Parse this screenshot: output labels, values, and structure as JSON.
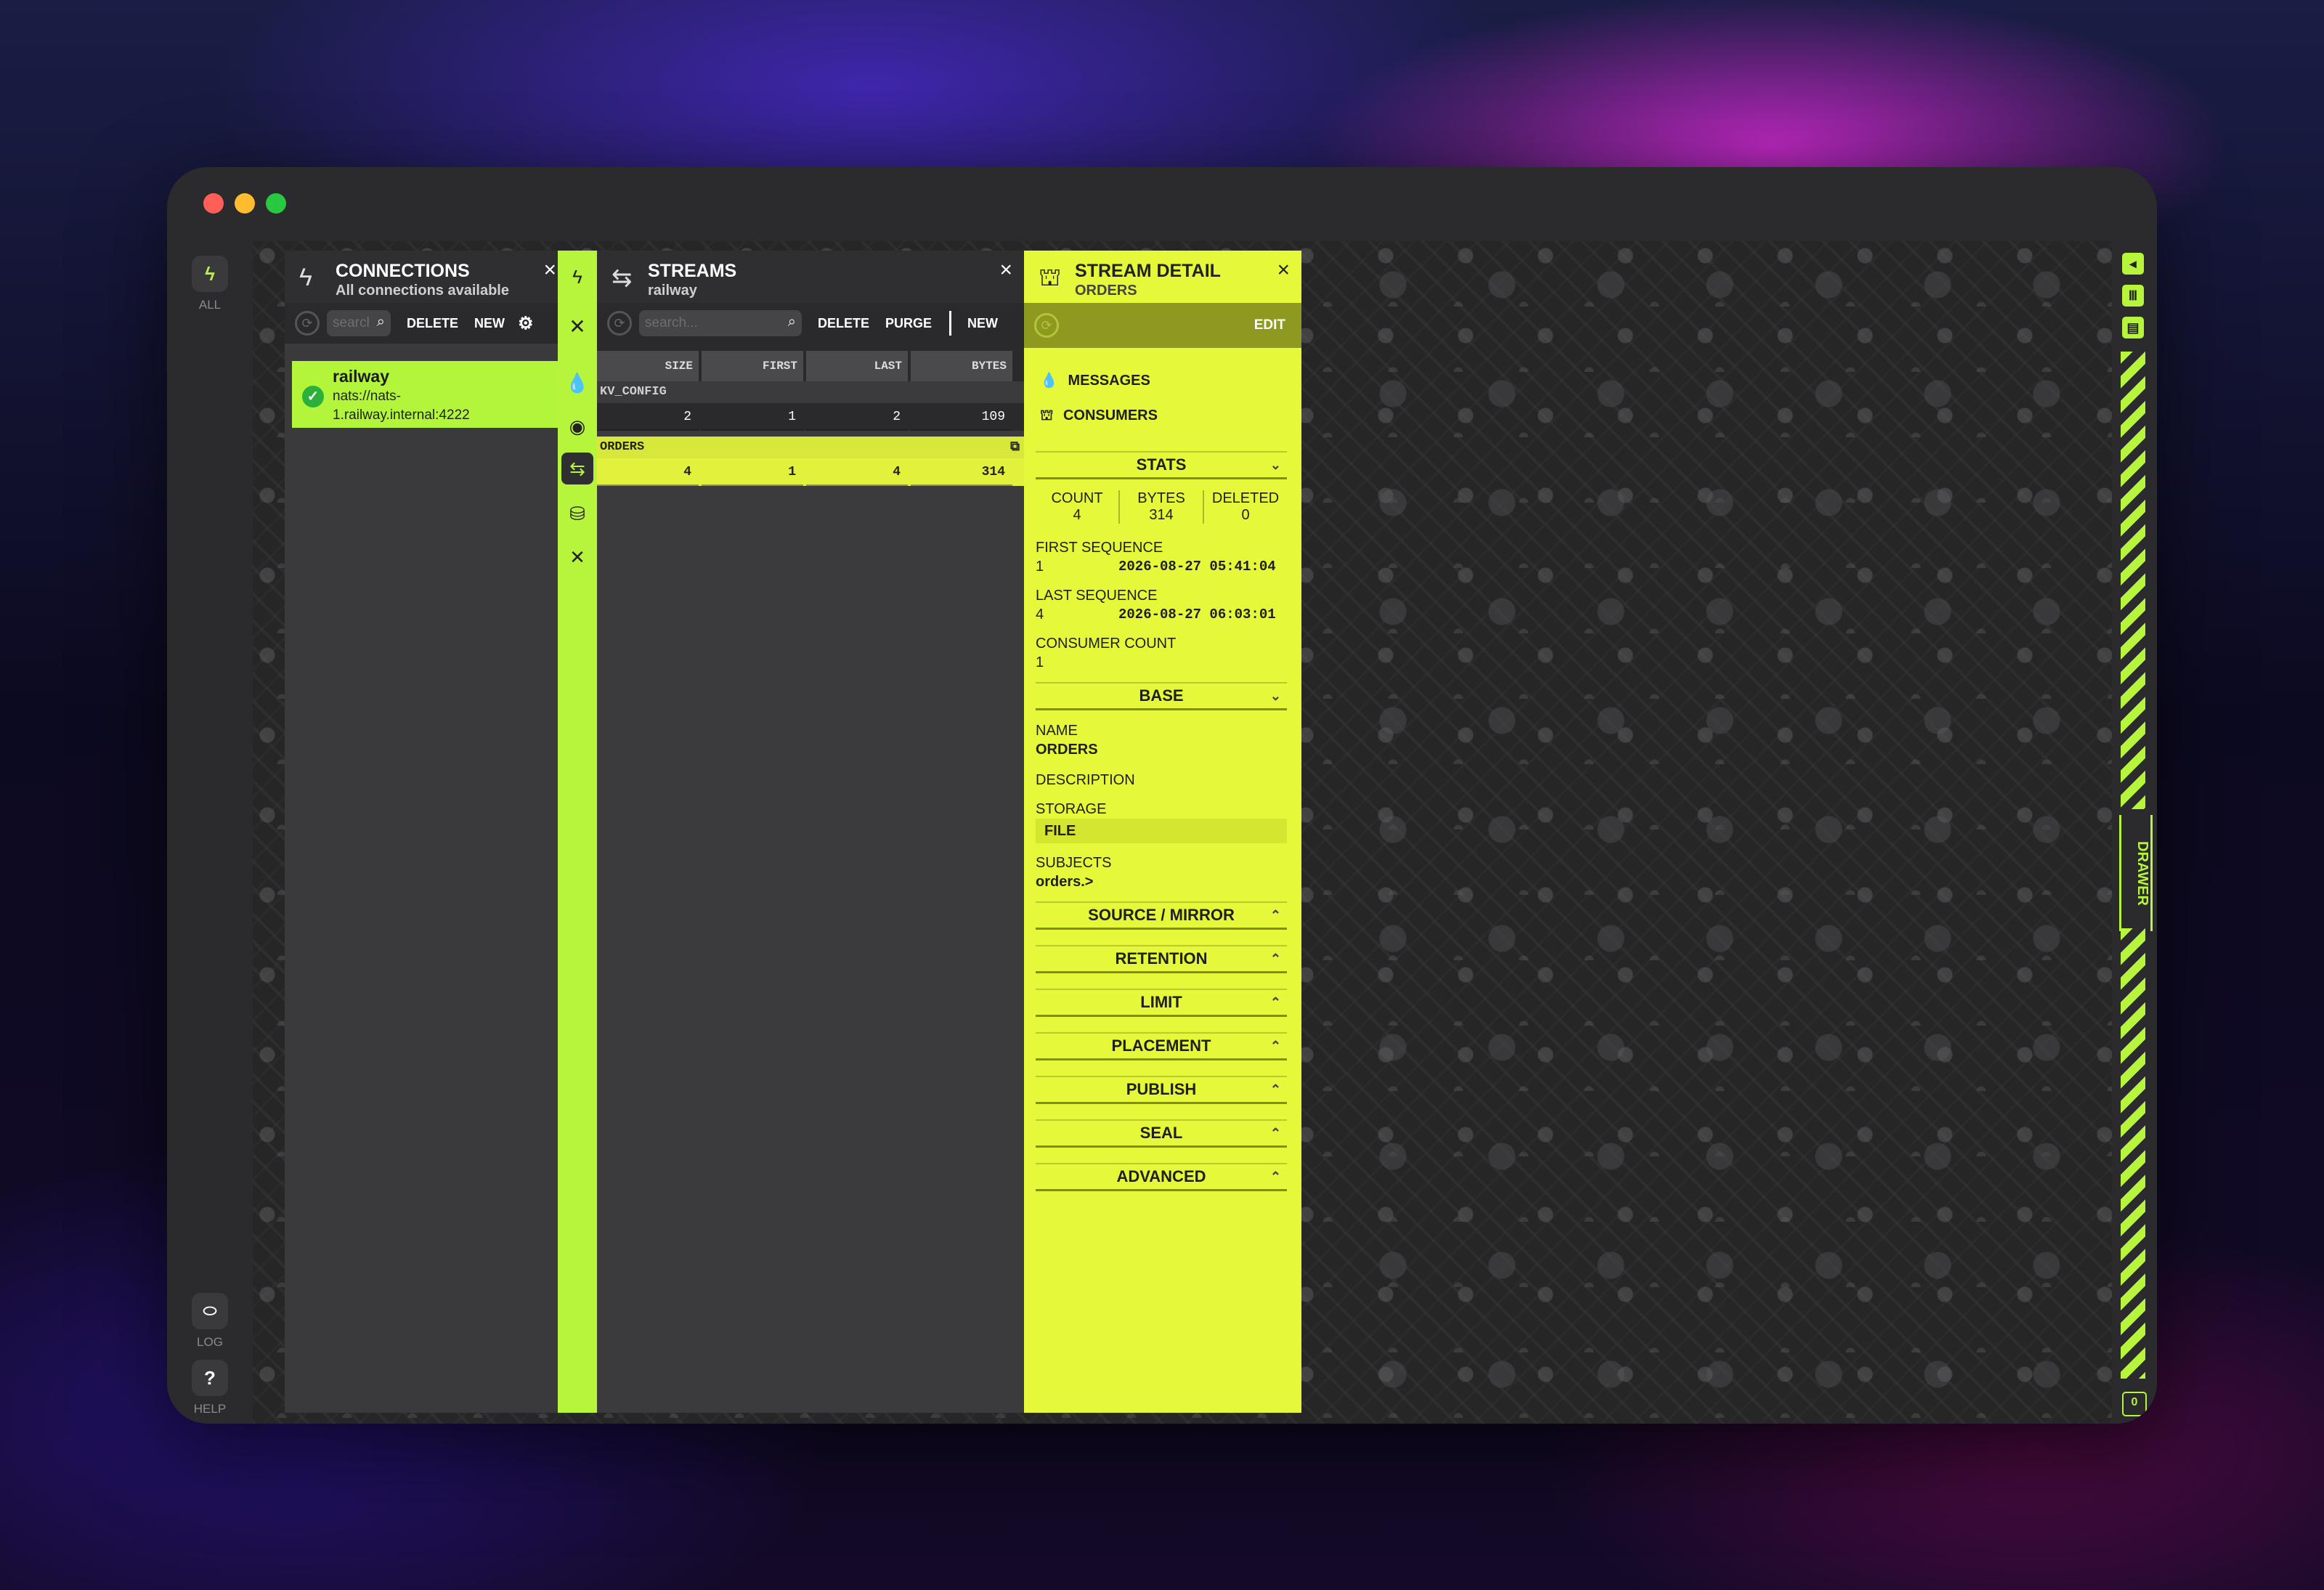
{
  "left_nav": {
    "all_label": "ALL",
    "log_label": "LOG",
    "help_label": "HELP",
    "help_glyph": "?"
  },
  "connections": {
    "title": "CONNECTIONS",
    "subtitle": "All connections available",
    "search_placeholder": "search...",
    "delete_label": "DELETE",
    "new_label": "NEW",
    "items": [
      {
        "name": "railway",
        "url": "nats://nats-1.railway.internal:4222",
        "status": "connected"
      }
    ]
  },
  "strip": {
    "close_glyph": "✕"
  },
  "streams": {
    "title": "STREAMS",
    "subtitle": "railway",
    "search_placeholder": "search...",
    "delete_label": "DELETE",
    "purge_label": "PURGE",
    "new_label": "NEW",
    "columns": [
      "SIZE",
      "FIRST",
      "LAST",
      "BYTES"
    ],
    "rows": [
      {
        "name": "KV_CONFIG",
        "size": "2",
        "first": "1",
        "last": "2",
        "bytes": "109",
        "selected": false
      },
      {
        "name": "ORDERS",
        "size": "4",
        "first": "1",
        "last": "4",
        "bytes": "314",
        "selected": true
      }
    ]
  },
  "detail": {
    "title": "STREAM DETAIL",
    "subtitle": "ORDERS",
    "edit_label": "EDIT",
    "messages_label": "MESSAGES",
    "consumers_label": "CONSUMERS",
    "stats": {
      "title": "STATS",
      "count_label": "COUNT",
      "count": "4",
      "bytes_label": "BYTES",
      "bytes": "314",
      "deleted_label": "DELETED",
      "deleted": "0",
      "first_seq_label": "FIRST SEQUENCE",
      "first_seq": "1",
      "first_seq_time": "2026-08-27 05:41:04",
      "last_seq_label": "LAST SEQUENCE",
      "last_seq": "4",
      "last_seq_time": "2026-08-27 06:03:01",
      "consumer_count_label": "CONSUMER COUNT",
      "consumer_count": "1"
    },
    "base": {
      "title": "BASE",
      "name_label": "NAME",
      "name": "ORDERS",
      "description_label": "DESCRIPTION",
      "storage_label": "STORAGE",
      "storage": "FILE",
      "subjects_label": "SUBJECTS",
      "subjects": "orders.>"
    },
    "sections": [
      "SOURCE / MIRROR",
      "RETENTION",
      "LIMIT",
      "PLACEMENT",
      "PUBLISH",
      "SEAL",
      "ADVANCED"
    ]
  },
  "rail": {
    "drawer_label": "DRAWER",
    "count": "0"
  },
  "colors": {
    "accent": "#b6f53b",
    "detail_bg": "#e6f83a",
    "panel_dark": "#3a3a3c"
  }
}
